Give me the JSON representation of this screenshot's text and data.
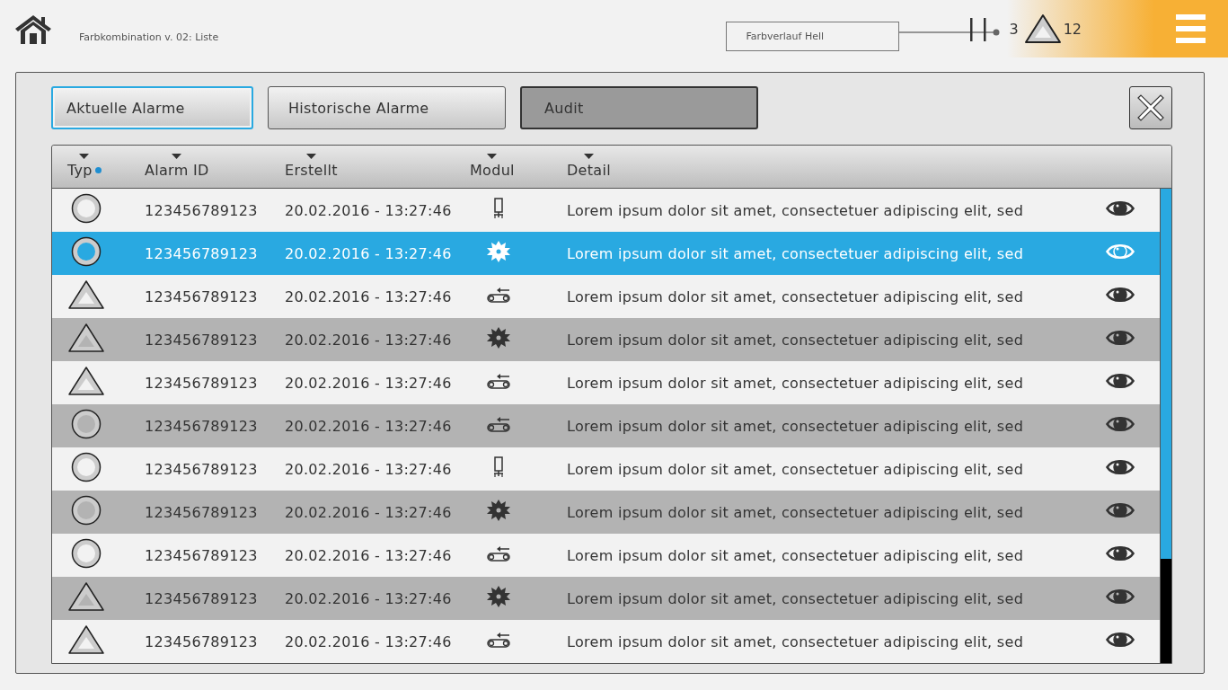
{
  "header": {
    "title": "Farbkombination v. 02: Liste",
    "theme_field": {
      "value": "Farbverlauf Hell"
    },
    "pause_count": "3",
    "warning_count": "12"
  },
  "tabs": [
    {
      "label": "Aktuelle Alarme",
      "selected": true,
      "disabled": false
    },
    {
      "label": "Historische Alarme",
      "selected": false,
      "disabled": false
    },
    {
      "label": "Audit",
      "selected": false,
      "disabled": true
    }
  ],
  "table": {
    "columns": [
      {
        "label": "Typ",
        "sorted": true
      },
      {
        "label": "Alarm ID",
        "sorted": false
      },
      {
        "label": "Erstellt",
        "sorted": false
      },
      {
        "label": "Modul",
        "sorted": false
      },
      {
        "label": "Detail",
        "sorted": false
      }
    ],
    "rows": [
      {
        "kind": "circle",
        "shaded": false,
        "selected": false,
        "alarm_id": "123456789123",
        "created": "20.02.2016 - 13:27:46",
        "module": {
          "kind": "tool"
        },
        "detail": "Lorem ipsum dolor sit amet, consectetuer adipiscing elit, sed"
      },
      {
        "kind": "circle",
        "shaded": false,
        "selected": true,
        "alarm_id": "123456789123",
        "created": "20.02.2016 - 13:27:46",
        "module": {
          "kind": "saw"
        },
        "detail": "Lorem ipsum dolor sit amet, consectetuer adipiscing elit, sed"
      },
      {
        "kind": "triangle",
        "shaded": false,
        "selected": false,
        "alarm_id": "123456789123",
        "created": "20.02.2016 - 13:27:46",
        "module": {
          "kind": "conveyor"
        },
        "detail": "Lorem ipsum dolor sit amet, consectetuer adipiscing elit, sed"
      },
      {
        "kind": "triangle",
        "shaded": true,
        "selected": false,
        "alarm_id": "123456789123",
        "created": "20.02.2016 - 13:27:46",
        "module": {
          "kind": "saw"
        },
        "detail": "Lorem ipsum dolor sit amet, consectetuer adipiscing elit, sed"
      },
      {
        "kind": "triangle",
        "shaded": false,
        "selected": false,
        "alarm_id": "123456789123",
        "created": "20.02.2016 - 13:27:46",
        "module": {
          "kind": "conveyor"
        },
        "detail": "Lorem ipsum dolor sit amet, consectetuer adipiscing elit, sed"
      },
      {
        "kind": "circle",
        "shaded": true,
        "selected": false,
        "alarm_id": "123456789123",
        "created": "20.02.2016 - 13:27:46",
        "module": {
          "kind": "conveyor"
        },
        "detail": "Lorem ipsum dolor sit amet, consectetuer adipiscing elit, sed"
      },
      {
        "kind": "circle",
        "shaded": false,
        "selected": false,
        "alarm_id": "123456789123",
        "created": "20.02.2016 - 13:27:46",
        "module": {
          "kind": "tool"
        },
        "detail": "Lorem ipsum dolor sit amet, consectetuer adipiscing elit, sed"
      },
      {
        "kind": "circle",
        "shaded": true,
        "selected": false,
        "alarm_id": "123456789123",
        "created": "20.02.2016 - 13:27:46",
        "module": {
          "kind": "saw"
        },
        "detail": "Lorem ipsum dolor sit amet, consectetuer adipiscing elit, sed"
      },
      {
        "kind": "circle",
        "shaded": false,
        "selected": false,
        "alarm_id": "123456789123",
        "created": "20.02.2016 - 13:27:46",
        "module": {
          "kind": "conveyor"
        },
        "detail": "Lorem ipsum dolor sit amet, consectetuer adipiscing elit, sed"
      },
      {
        "kind": "triangle",
        "shaded": true,
        "selected": false,
        "alarm_id": "123456789123",
        "created": "20.02.2016 - 13:27:46",
        "module": {
          "kind": "saw"
        },
        "detail": "Lorem ipsum dolor sit amet, consectetuer adipiscing elit, sed"
      },
      {
        "kind": "triangle",
        "shaded": false,
        "selected": false,
        "alarm_id": "123456789123",
        "created": "20.02.2016 - 13:27:46",
        "module": {
          "kind": "conveyor"
        },
        "detail": "Lorem ipsum dolor sit amet, consectetuer adipiscing elit, sed"
      }
    ]
  }
}
